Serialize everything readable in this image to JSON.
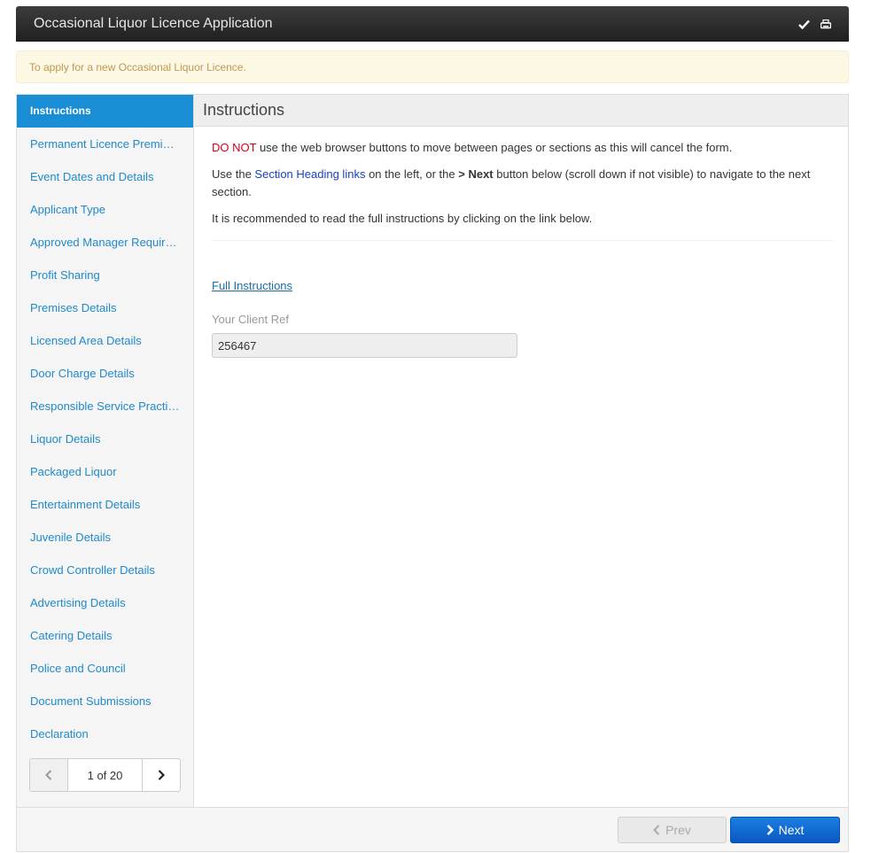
{
  "window": {
    "title": "Occasional Liquor Licence Application"
  },
  "banner": {
    "text": "To apply for a new Occasional Liquor Licence."
  },
  "sidebar": {
    "items": [
      {
        "label": "Instructions",
        "active": true
      },
      {
        "label": "Permanent Licence Premises"
      },
      {
        "label": "Event Dates and Details"
      },
      {
        "label": "Applicant Type"
      },
      {
        "label": "Approved Manager Requirements"
      },
      {
        "label": "Profit Sharing"
      },
      {
        "label": "Premises Details"
      },
      {
        "label": "Licensed Area Details"
      },
      {
        "label": "Door Charge Details"
      },
      {
        "label": "Responsible Service Practices"
      },
      {
        "label": "Liquor Details"
      },
      {
        "label": "Packaged Liquor"
      },
      {
        "label": "Entertainment Details"
      },
      {
        "label": "Juvenile Details"
      },
      {
        "label": "Crowd Controller Details"
      },
      {
        "label": "Advertising Details"
      },
      {
        "label": "Catering Details"
      },
      {
        "label": "Police and Council"
      },
      {
        "label": "Document Submissions"
      },
      {
        "label": "Declaration"
      }
    ],
    "pager": {
      "count": "1 of 20"
    }
  },
  "main": {
    "heading": "Instructions",
    "para1": {
      "warning": "DO NOT",
      "rest": " use the web browser buttons to move between pages or sections as this will cancel the form."
    },
    "para2": {
      "pre": "Use the ",
      "link": "Section Heading links",
      "mid": " on the left, or the ",
      "bold": "> Next",
      "post": " button below (scroll down if not visible) to navigate to the next section."
    },
    "para3": "It is recommended to read the full instructions by clicking on the link below.",
    "full_instructions_link": "Full Instructions",
    "client_ref": {
      "label": "Your Client Ref",
      "value": "256467"
    }
  },
  "footer": {
    "prev_label": "Prev",
    "next_label": "Next"
  },
  "colors": {
    "accent": "#1a8ed4",
    "warning": "#d0021b",
    "primary_button": "#0a58c2"
  }
}
